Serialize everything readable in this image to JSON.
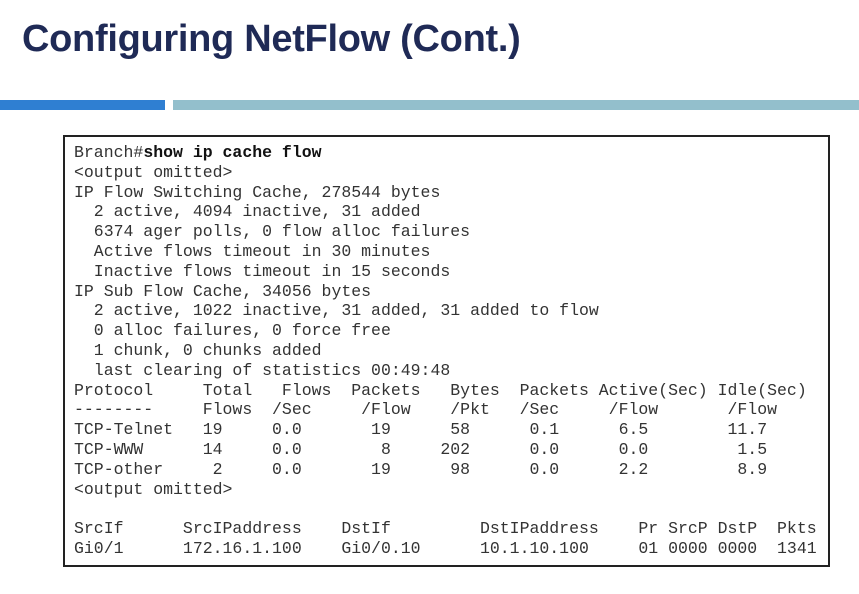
{
  "slide": {
    "title": "Configuring NetFlow (Cont.)"
  },
  "colors": {
    "title": "#1f2a56",
    "accent_bar": "#2f7fd2",
    "secondary_bar": "#93bfcc"
  },
  "terminal": {
    "prompt": "Branch#",
    "command": "show ip cache flow",
    "lines": [
      "<output omitted>",
      "IP Flow Switching Cache, 278544 bytes",
      "  2 active, 4094 inactive, 31 added",
      "  6374 ager polls, 0 flow alloc failures",
      "  Active flows timeout in 30 minutes",
      "  Inactive flows timeout in 15 seconds",
      "IP Sub Flow Cache, 34056 bytes",
      "  2 active, 1022 inactive, 31 added, 31 added to flow",
      "  0 alloc failures, 0 force free",
      "  1 chunk, 0 chunks added",
      "  last clearing of statistics 00:49:48"
    ],
    "protocol_table": [
      "Protocol     Total   Flows  Packets   Bytes  Packets Active(Sec) Idle(Sec)",
      "--------     Flows  /Sec     /Flow    /Pkt   /Sec     /Flow       /Flow",
      "TCP-Telnet   19     0.0       19      58      0.1      6.5        11.7",
      "TCP-WWW      14     0.0        8     202      0.0      0.0         1.5",
      "TCP-other     2     0.0       19      98      0.0      2.2         8.9",
      "<output omitted>"
    ],
    "flow_table": [
      "SrcIf      SrcIPaddress    DstIf         DstIPaddress    Pr SrcP DstP  Pkts",
      "Gi0/1      172.16.1.100    Gi0/0.10      10.1.10.100     01 0000 0000  1341"
    ]
  }
}
